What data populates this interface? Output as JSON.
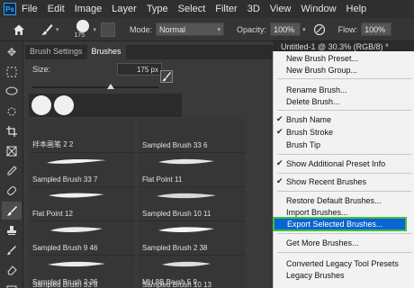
{
  "app": {
    "logo": "Ps"
  },
  "menubar": [
    "File",
    "Edit",
    "Image",
    "Layer",
    "Type",
    "Select",
    "Filter",
    "3D",
    "View",
    "Window",
    "Help"
  ],
  "options": {
    "brush_size": "175",
    "mode_label": "Mode:",
    "mode_value": "Normal",
    "opacity_label": "Opacity:",
    "opacity_value": "100%",
    "flow_label": "Flow:",
    "flow_value": "100%"
  },
  "panel": {
    "tabs": [
      "Brush Settings",
      "Brushes"
    ],
    "size_label": "Size:",
    "size_value": "175 px"
  },
  "brushes": [
    "拌本画笔 2 2",
    "Sampled Brush 33 6",
    "Sampled Brush 33 7",
    "Flat Point 11",
    "Flat Point 12",
    "Sampled Brush 10 11",
    "Sampled Brush 9 46",
    "Sampled Brush 2 38",
    "Sampled Brush 2 36",
    "MH 8B Brush 5 9",
    "Sampled Brush 33 8",
    "Sampled Brush 10 13"
  ],
  "document": {
    "tab_title": "Untitled-1 @ 30.3% (RGB/8) *"
  },
  "flyout": {
    "items": [
      {
        "label": "New Brush Preset...",
        "checked": false
      },
      {
        "label": "New Brush Group...",
        "checked": false
      },
      {
        "label": "Rename Brush...",
        "checked": false
      },
      {
        "label": "Delete Brush...",
        "checked": false
      },
      {
        "label": "Brush Name",
        "checked": true
      },
      {
        "label": "Brush Stroke",
        "checked": true
      },
      {
        "label": "Brush Tip",
        "checked": false
      },
      {
        "label": "Show Additional Preset Info",
        "checked": true
      },
      {
        "label": "Show Recent Brushes",
        "checked": true
      },
      {
        "label": "Restore Default Brushes...",
        "checked": false
      },
      {
        "label": "Import Brushes...",
        "checked": false
      },
      {
        "label": "Export Selected Brushes...",
        "checked": false,
        "highlighted": true
      },
      {
        "label": "Get More Brushes...",
        "checked": false
      },
      {
        "label": "Converted Legacy Tool Presets",
        "checked": false
      },
      {
        "label": "Legacy Brushes",
        "checked": false
      }
    ],
    "check_glyph": "✔"
  },
  "colors": {
    "highlight": "#0a64d2",
    "highlight_outline": "#3fbf3f",
    "ps_blue": "#31a8ff"
  }
}
